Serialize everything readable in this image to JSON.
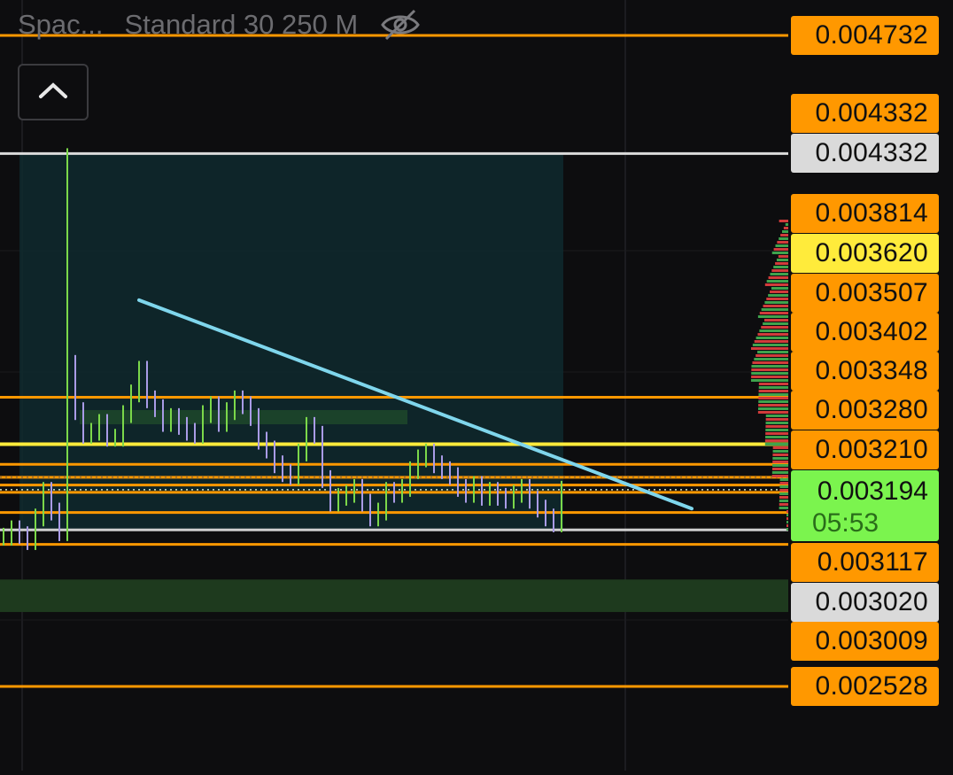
{
  "legend": {
    "indicator_name": "Spac...",
    "indicator_params": "Standard 30 250 M",
    "visibility_icon": "eye-slash-icon"
  },
  "collapse_button": {
    "icon": "chevron-up-icon"
  },
  "colors": {
    "background": "#0d0d0f",
    "level_orange": "#ff9800",
    "level_yellow": "#ffeb3b",
    "level_grey": "#dadada",
    "trendline": "#7fd6ec",
    "candle_up": "#7bd84a",
    "candle_down": "#a99be6",
    "zone_fill": "#1e3a1e",
    "range_box": "#0f2a2e",
    "volume_profile_up": "#3fa34d",
    "volume_profile_down": "#d13b3b",
    "current_price": "#7bf44e"
  },
  "price_scale": {
    "badges": [
      {
        "label": "0.004732",
        "style": "orange"
      },
      {
        "label": "0.004332",
        "style": "orange"
      },
      {
        "label": "0.004332",
        "style": "grey"
      },
      {
        "label": "0.003814",
        "style": "orange"
      },
      {
        "label": "0.003620",
        "style": "yellow"
      },
      {
        "label": "0.003507",
        "style": "orange"
      },
      {
        "label": "0.003402",
        "style": "orange"
      },
      {
        "label": "0.003348",
        "style": "orange"
      },
      {
        "label": "0.003280",
        "style": "orange"
      },
      {
        "label": "0.003210",
        "style": "orange"
      },
      {
        "label": "0.003117",
        "style": "orange"
      },
      {
        "label": "0.003020",
        "style": "grey"
      },
      {
        "label": "0.003009",
        "style": "orange"
      },
      {
        "label": "0.002528",
        "style": "orange"
      }
    ],
    "current": {
      "price": "0.003194",
      "countdown": "05:53"
    }
  },
  "chart_data": {
    "type": "line",
    "title": "",
    "ylim": [
      0.00248,
      0.00484
    ],
    "grid": true,
    "horizontal_levels": [
      {
        "price": 0.004732,
        "color": "orange"
      },
      {
        "price": 0.004332,
        "color": "grey"
      },
      {
        "price": 0.003507,
        "color": "orange"
      },
      {
        "price": 0.003348,
        "color": "yellow"
      },
      {
        "price": 0.00328,
        "color": "orange"
      },
      {
        "price": 0.003236,
        "color": "orange"
      },
      {
        "price": 0.00321,
        "color": "orange"
      },
      {
        "price": 0.003185,
        "color": "orange"
      },
      {
        "price": 0.003117,
        "color": "orange"
      },
      {
        "price": 0.003009,
        "color": "orange"
      },
      {
        "price": 0.002528,
        "color": "orange"
      }
    ],
    "zones": [
      {
        "from": 0.00289,
        "to": 0.00278,
        "color": "green"
      }
    ],
    "trendline": {
      "start": 0.00368,
      "end": 0.00313
    },
    "close_series": [
      0.003035,
      0.00306,
      0.00304,
      0.00302,
      0.0031,
      0.00319,
      0.00312,
      0.00305,
      0.00362,
      0.00346,
      0.00338,
      0.00339,
      0.00342,
      0.00337,
      0.00337,
      0.00345,
      0.00352,
      0.0036,
      0.0035,
      0.00347,
      0.00342,
      0.00344,
      0.00341,
      0.00339,
      0.00338,
      0.00345,
      0.00348,
      0.00342,
      0.00346,
      0.0035,
      0.00348,
      0.00344,
      0.00336,
      0.00333,
      0.00328,
      0.00325,
      0.00324,
      0.00332,
      0.00341,
      0.00338,
      0.00323,
      0.00315,
      0.00317,
      0.00318,
      0.0032,
      0.00315,
      0.0031,
      0.00312,
      0.00319,
      0.00318,
      0.0032,
      0.00326,
      0.0033,
      0.00332,
      0.00328,
      0.00326,
      0.00324,
      0.0032,
      0.00318,
      0.00321,
      0.00317,
      0.00319,
      0.00317,
      0.00316,
      0.00318,
      0.0032,
      0.00316,
      0.00313,
      0.0031,
      0.00308,
      0.003194
    ]
  }
}
